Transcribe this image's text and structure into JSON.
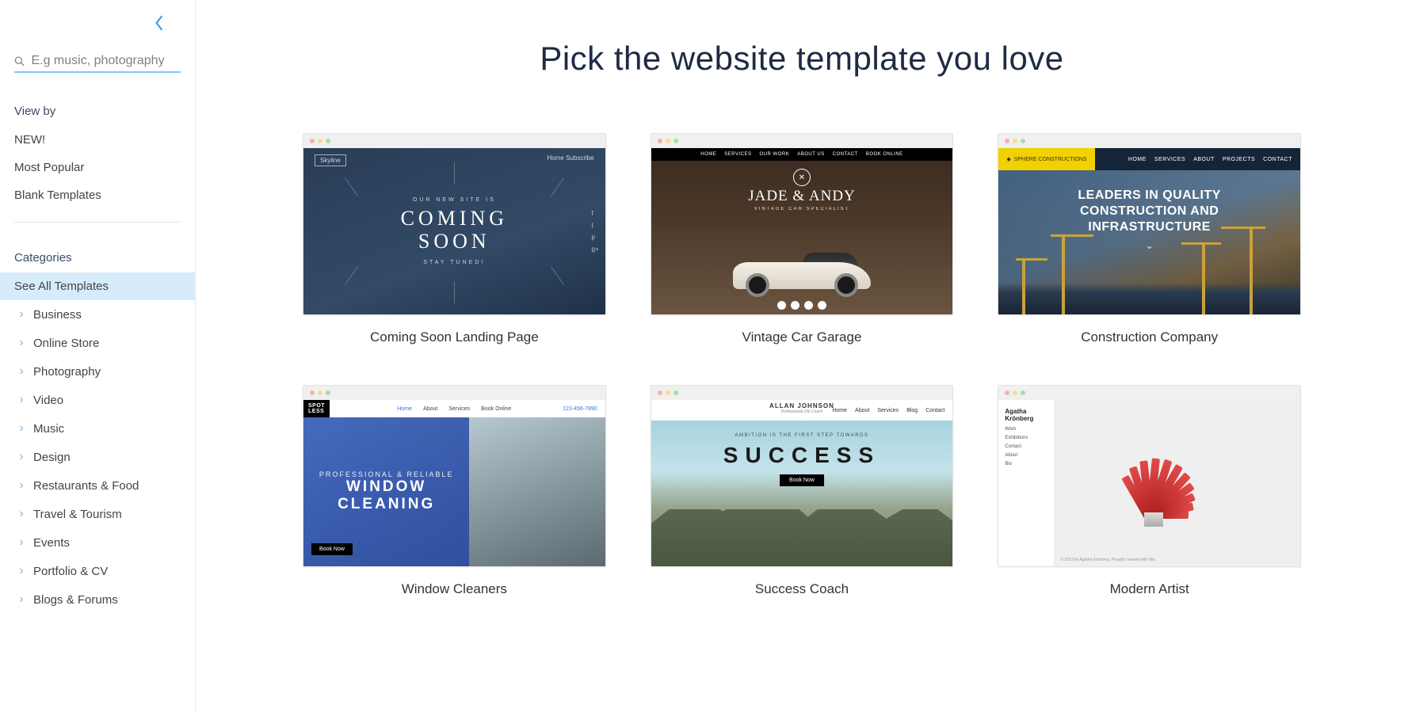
{
  "sidebar": {
    "search_placeholder": "E.g music, photography",
    "viewby_label": "View by",
    "viewby_items": [
      "NEW!",
      "Most Popular",
      "Blank Templates"
    ],
    "categories_label": "Categories",
    "see_all": "See All Templates",
    "categories": [
      "Business",
      "Online Store",
      "Photography",
      "Video",
      "Music",
      "Design",
      "Restaurants & Food",
      "Travel & Tourism",
      "Events",
      "Portfolio & CV",
      "Blogs & Forums"
    ]
  },
  "main": {
    "title": "Pick the website template you love",
    "templates": [
      {
        "name": "Coming Soon Landing Page"
      },
      {
        "name": "Vintage Car Garage"
      },
      {
        "name": "Construction Company"
      },
      {
        "name": "Window Cleaners"
      },
      {
        "name": "Success Coach"
      },
      {
        "name": "Modern Artist"
      }
    ]
  },
  "thumbs": {
    "t1": {
      "logo": "Skyline",
      "nav": "Home   Subscribe",
      "sub": "OUR NEW SITE IS",
      "title_line1": "COMING",
      "title_line2": "SOON",
      "stay": "STAY TUNED!"
    },
    "t2": {
      "nav": [
        "HOME",
        "SERVICES",
        "OUR WORK",
        "ABOUT US",
        "CONTACT",
        "BOOK ONLINE"
      ],
      "emblem": "✕",
      "brand": "JADE & ANDY",
      "tag": "VINTAGE CAR SPECIALIST"
    },
    "t3": {
      "brand": "SPHERE CONSTRUCTIONS",
      "nav": [
        "HOME",
        "SERVICES",
        "ABOUT",
        "PROJECTS",
        "CONTACT"
      ],
      "headline_l1": "LEADERS IN QUALITY",
      "headline_l2": "CONSTRUCTION AND",
      "headline_l3": "INFRASTRUCTURE"
    },
    "t4": {
      "logo": "SPOT\nLESS",
      "nav": [
        "Home",
        "About",
        "Services",
        "Book Online"
      ],
      "phone": "123-456-7890",
      "pro": "PROFESSIONAL & RELIABLE",
      "title_l1": "WINDOW",
      "title_l2": "CLEANING",
      "book": "Book Now"
    },
    "t5": {
      "brand": "ALLAN JOHNSON",
      "brand_sub": "Professional Life Coach",
      "nav": [
        "Home",
        "About",
        "Services",
        "Blog",
        "Contact"
      ],
      "tag": "AMBITION IS THE FIRST STEP TOWARDS",
      "title": "SUCCESS",
      "book": "Book Now"
    },
    "t6": {
      "name": "Agatha Krönberg",
      "menu": [
        "Work",
        "Exhibitions",
        "Contact",
        "About",
        "Bio"
      ]
    }
  }
}
